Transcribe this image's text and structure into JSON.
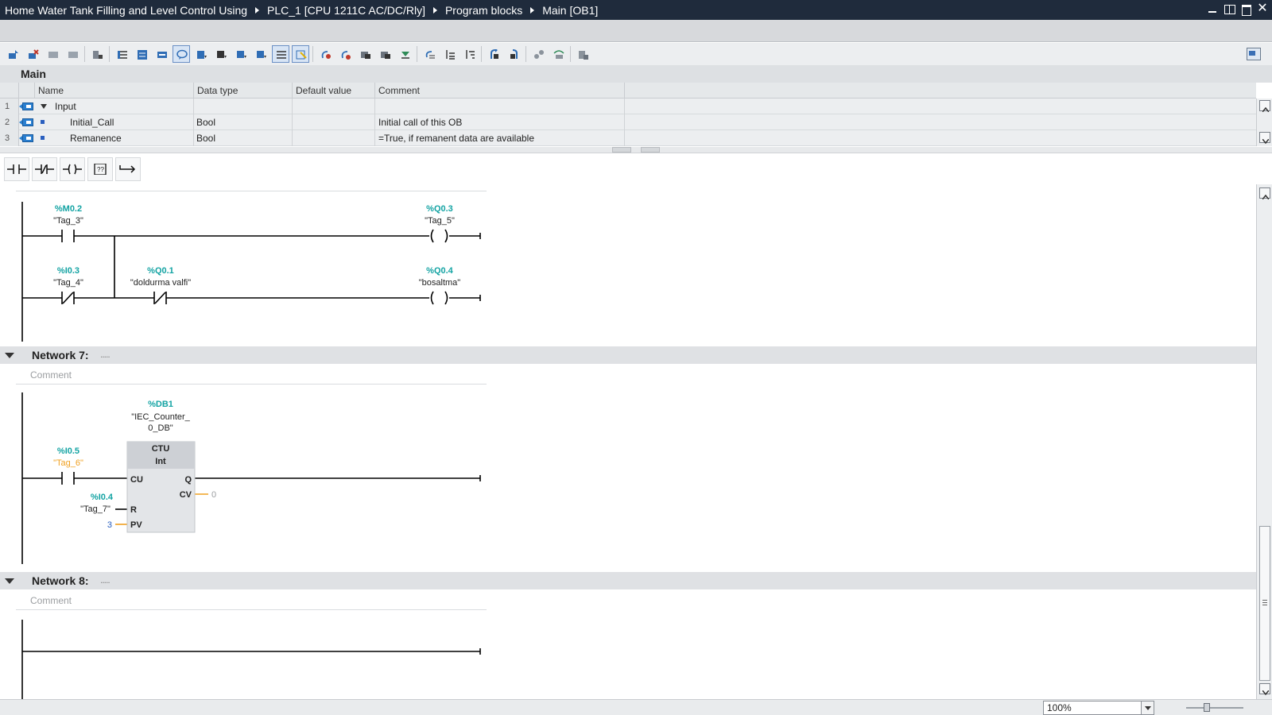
{
  "titlebar": {
    "crumbs": [
      "Home Water Tank Filling and Level Control Using",
      "PLC_1 [CPU 1211C AC/DC/Rly]",
      "Program blocks",
      "Main [OB1]"
    ],
    "close_glyph": "✕"
  },
  "interface": {
    "title": "Main",
    "columns": [
      "Name",
      "Data type",
      "Default value",
      "Comment"
    ],
    "rows": [
      {
        "num": "1",
        "name": "Input",
        "type": "",
        "default": "",
        "comment": ""
      },
      {
        "num": "2",
        "name": "Initial_Call",
        "type": "Bool",
        "default": "",
        "comment": "Initial call of this OB"
      },
      {
        "num": "3",
        "name": "Remanence",
        "type": "Bool",
        "default": "",
        "comment": "=True, if remanent data are available"
      }
    ]
  },
  "network6": {
    "m02_addr": "%M0.2",
    "m02_tag": "\"Tag_3\"",
    "i03_addr": "%I0.3",
    "i03_tag": "\"Tag_4\"",
    "q01_addr": "%Q0.1",
    "q01_tag": "\"doldurma valfi\"",
    "q03_addr": "%Q0.3",
    "q03_tag": "\"Tag_5\"",
    "q04_addr": "%Q0.4",
    "q04_tag": "\"bosaltma\""
  },
  "network7": {
    "title": "Network 7:",
    "dots": ".....",
    "comment": "Comment",
    "db_addr": "%DB1",
    "db_tag_line1": "\"IEC_Counter_",
    "db_tag_line2": "0_DB\"",
    "block_type": "CTU",
    "block_dtype": "Int",
    "pin_cu": "CU",
    "pin_q": "Q",
    "pin_cv": "CV",
    "pin_r": "R",
    "pin_pv": "PV",
    "cv_value": "0",
    "pv_value": "3",
    "i05_addr": "%I0.5",
    "i05_tag": "\"Tag_6\"",
    "i04_addr": "%I0.4",
    "i04_tag": "\"Tag_7\""
  },
  "network8": {
    "title": "Network 8:",
    "dots": ".....",
    "comment": "Comment"
  },
  "statusbar": {
    "zoom": "100%"
  },
  "colors": {
    "address": "#13a3a3",
    "tag_warning": "#f0a020",
    "titlebar": "#1f2b3c",
    "wire": "#000000"
  }
}
